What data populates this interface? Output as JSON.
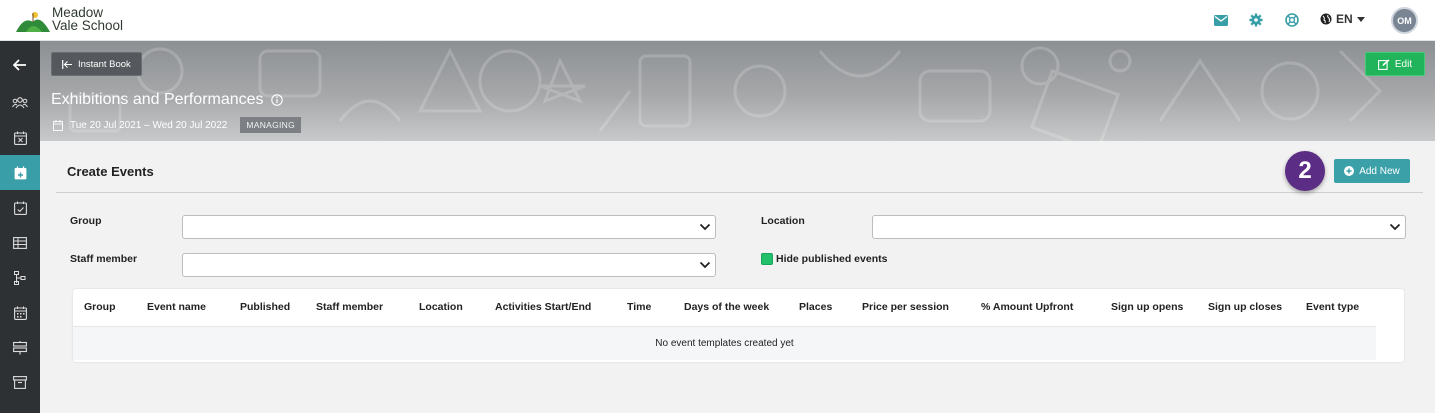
{
  "header": {
    "school_name_line1": "Meadow",
    "school_name_line2": "Vale School",
    "language": "EN",
    "avatar_initials": "OM",
    "icons": [
      "mail-icon",
      "gear-icon",
      "globe-support-icon",
      "globe-icon"
    ],
    "accent_color": "#3a9ea8"
  },
  "sidebar": {
    "items": [
      {
        "icon": "back-arrow-icon",
        "active": false
      },
      {
        "icon": "users-icon",
        "active": false
      },
      {
        "icon": "calendar-x-icon",
        "active": false
      },
      {
        "icon": "calendar-plus-icon",
        "active": true
      },
      {
        "icon": "calendar-check-icon",
        "active": false
      },
      {
        "icon": "table-icon",
        "active": false
      },
      {
        "icon": "flowchart-icon",
        "active": false
      },
      {
        "icon": "calendar-grid-icon",
        "active": false
      },
      {
        "icon": "signpost-icon",
        "active": false
      },
      {
        "icon": "archive-icon",
        "active": false
      }
    ]
  },
  "banner": {
    "back_label": "Instant Book",
    "edit_label": "Edit",
    "title": "Exhibitions and Performances",
    "date_range": "Tue 20 Jul 2021 – Wed 20 Jul 2022",
    "status_badge": "MANAGING"
  },
  "section": {
    "title": "Create Events",
    "step_number": "2",
    "add_label": "Add New"
  },
  "filters": {
    "group_label": "Group",
    "group_value": "",
    "location_label": "Location",
    "location_value": "",
    "staff_label": "Staff member",
    "staff_value": "",
    "hide_published_label": "Hide published events",
    "hide_published_checked": true
  },
  "table": {
    "columns": [
      "Group",
      "Event name",
      "Published",
      "Staff member",
      "Location",
      "Activities Start/End",
      "Time",
      "Days of the week",
      "Places",
      "Price per session",
      "% Amount Upfront",
      "Sign up opens",
      "Sign up closes",
      "Event type"
    ],
    "empty_message": "No event templates created yet"
  }
}
